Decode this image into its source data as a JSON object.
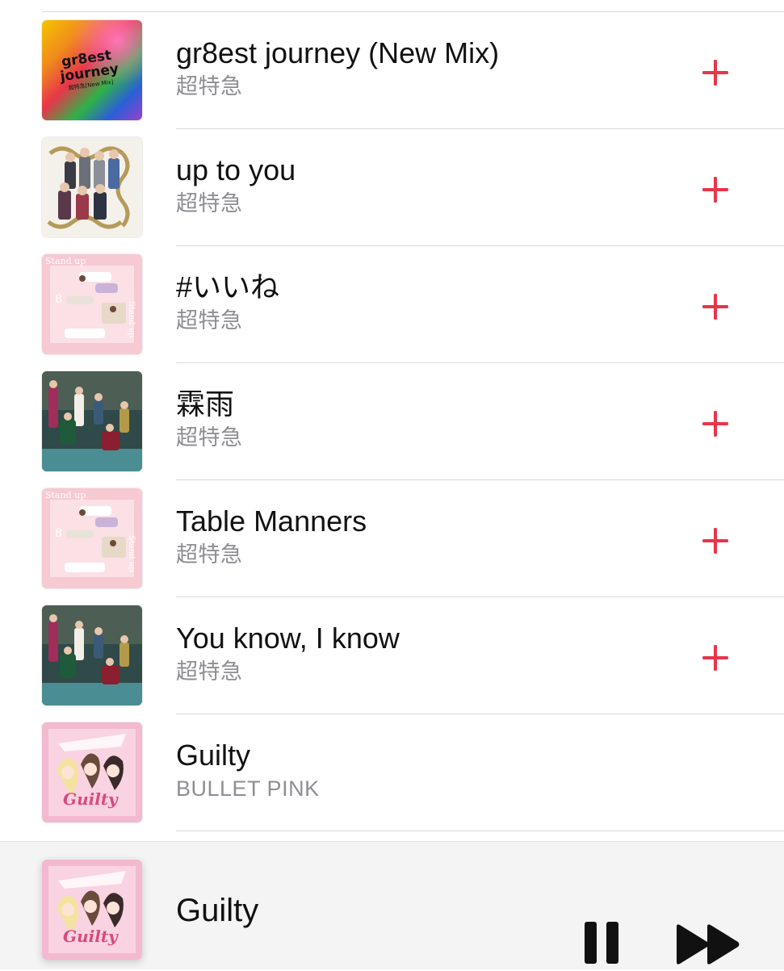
{
  "tracks": [
    {
      "title": "gr8est journey (New Mix)",
      "artist": "超特急",
      "artwork": "gr8est-journey-rainbow-art",
      "art_text_1": "gr8est",
      "art_text_2": "journey",
      "art_text_3": "超特急[New Mix]",
      "has_add": true
    },
    {
      "title": "up to you",
      "artist": "超特急",
      "artwork": "group-photo-cream-art",
      "has_add": true
    },
    {
      "title": "#いいね",
      "artist": "超特急",
      "artwork": "stand-up-pink-art",
      "art_text_1": "Stand up",
      "art_text_2": "8",
      "has_add": true
    },
    {
      "title": "霖雨",
      "artist": "超特急",
      "artwork": "group-photo-dark-art",
      "has_add": true
    },
    {
      "title": "Table Manners",
      "artist": "超特急",
      "artwork": "stand-up-pink-art",
      "art_text_1": "Stand up",
      "art_text_2": "8",
      "has_add": true
    },
    {
      "title": "You know, I know",
      "artist": "超特急",
      "artwork": "group-photo-dark-art",
      "has_add": true
    },
    {
      "title": "Guilty",
      "artist": "BULLET PINK",
      "artwork": "guilty-pink-illustration-art",
      "art_text_1": "Guilty",
      "has_add": false
    }
  ],
  "now_playing": {
    "title": "Guilty",
    "artwork": "guilty-pink-illustration-art",
    "art_text_1": "Guilty",
    "pause_icon": "pause-icon",
    "forward_icon": "fast-forward-icon"
  },
  "colors": {
    "accent": "#e8354a",
    "text_primary": "#111111",
    "text_secondary": "#8e8e93",
    "separator": "#d9d9db",
    "mini_player_bg": "#f4f4f5"
  }
}
